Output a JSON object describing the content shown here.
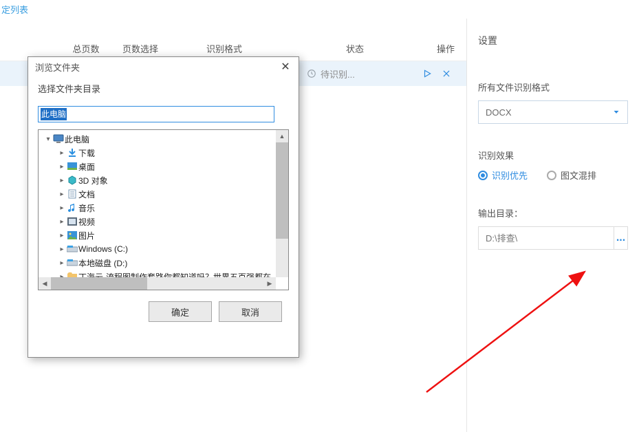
{
  "top_tab": "定列表",
  "table": {
    "headers": {
      "pages": "总页数",
      "page_select": "页数选择",
      "format": "识别格式",
      "status": "状态",
      "action": "操作"
    },
    "row": {
      "status": "待识别..."
    }
  },
  "sidebar": {
    "title": "设置",
    "format": {
      "label": "所有文件识别格式",
      "value": "DOCX"
    },
    "quality": {
      "label": "识别效果",
      "opt_priority": "识别优先",
      "opt_mixed": "图文混排"
    },
    "outdir": {
      "label": "输出目录：",
      "value": "D:\\排查\\",
      "btn": "..."
    }
  },
  "dialog": {
    "title": "浏览文件夹",
    "subtitle": "选择文件夹目录",
    "path": "此电脑",
    "tree": {
      "this_pc": "此电脑",
      "downloads": "下载",
      "desktop": "桌面",
      "3dobj": "3D 对象",
      "documents": "文档",
      "music": "音乐",
      "videos": "视频",
      "pictures": "图片",
      "winc": "Windows (C:)",
      "locald": "本地磁盘 (D:)",
      "longfolder": "丁海云-流程图制作套路你都知道吗？世界五百强都在"
    },
    "ok": "确定",
    "cancel": "取消"
  }
}
